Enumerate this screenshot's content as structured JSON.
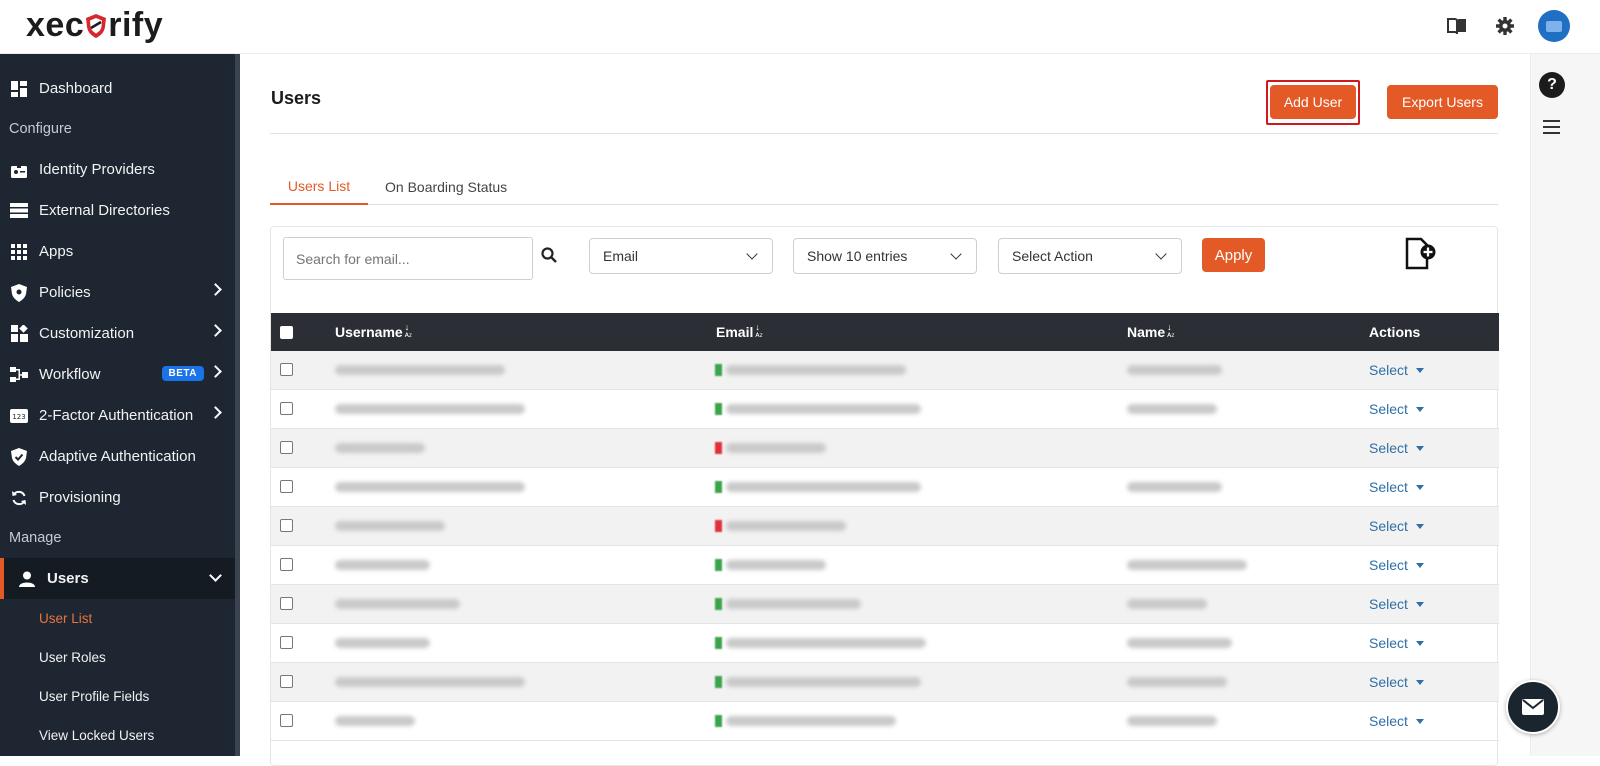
{
  "app": {
    "logo_text_left": "xec",
    "logo_text_right": "rify"
  },
  "sidebar": {
    "items": [
      {
        "label": "Dashboard",
        "icon": "dashboard-icon"
      },
      {
        "section": "Configure"
      },
      {
        "label": "Identity Providers",
        "icon": "id-badge-icon"
      },
      {
        "label": "External Directories",
        "icon": "directory-icon"
      },
      {
        "label": "Apps",
        "icon": "apps-grid-icon"
      },
      {
        "label": "Policies",
        "icon": "shield-icon"
      },
      {
        "label": "Customization",
        "icon": "customization-icon"
      },
      {
        "label": "Workflow",
        "icon": "workflow-icon",
        "badge": "BETA"
      },
      {
        "label": "2-Factor Authentication",
        "icon": "two-factor-icon"
      },
      {
        "label": "Adaptive Authentication",
        "icon": "shield-check-icon"
      },
      {
        "label": "Provisioning",
        "icon": "sync-icon"
      },
      {
        "section": "Manage"
      },
      {
        "label": "Users",
        "icon": "user-icon"
      }
    ],
    "sub_items": [
      "User List",
      "User Roles",
      "User Profile Fields",
      "View Locked Users"
    ]
  },
  "main": {
    "title": "Users",
    "add_user": "Add User",
    "export_users": "Export Users",
    "tabs": [
      "Users List",
      "On Boarding Status"
    ],
    "search_placeholder": "Search for email...",
    "filter_field": "Email",
    "entries": "Show 10 entries",
    "action": "Select Action",
    "apply": "Apply",
    "columns": [
      "Username",
      "Email",
      "Name",
      "Actions"
    ],
    "row_action": "Select",
    "rows": [
      {
        "status": "green",
        "u": 170,
        "e": 180,
        "n": 95
      },
      {
        "status": "green",
        "u": 190,
        "e": 195,
        "n": 90
      },
      {
        "status": "red",
        "u": 90,
        "e": 100,
        "n": 0
      },
      {
        "status": "green",
        "u": 190,
        "e": 195,
        "n": 95
      },
      {
        "status": "red",
        "u": 110,
        "e": 120,
        "n": 0
      },
      {
        "status": "green",
        "u": 95,
        "e": 100,
        "n": 120
      },
      {
        "status": "green",
        "u": 125,
        "e": 135,
        "n": 80
      },
      {
        "status": "green",
        "u": 95,
        "e": 200,
        "n": 105
      },
      {
        "status": "green",
        "u": 190,
        "e": 195,
        "n": 100
      },
      {
        "status": "green",
        "u": 80,
        "e": 170,
        "n": 90
      }
    ]
  },
  "colors": {
    "accent": "#e35a26",
    "sidebar": "#1d2631",
    "link": "#2f6fa6"
  }
}
